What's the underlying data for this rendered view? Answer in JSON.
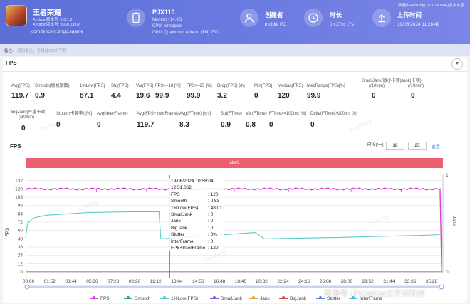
{
  "app": {
    "name": "王者荣耀",
    "android_version": "Android版本号: 9.3.1.6",
    "android_code": "Android版本号: 903010602",
    "package": "com.tencent.tmgp.sgame"
  },
  "device": {
    "name": "PJX110",
    "memory": "Memory: 14.9G",
    "cpu": "CPU: pineapple",
    "gpu": "GPU: Qualcomm Adreno (TM) 750"
  },
  "creator": {
    "label": "创建者",
    "value": "mobile PC"
  },
  "duration": {
    "label": "时长",
    "value": "0h 37m 17s"
  },
  "upload": {
    "label": "上传时间",
    "value": "19/06/2024 11:28:49"
  },
  "perfdog_version": "数据由PerfDog(10.3.240546)版本本版",
  "note": {
    "label": "备注:",
    "placeholder": "添加备注，不超过200个字符"
  },
  "section_title": "FPS",
  "stats_row1": [
    {
      "label": "Avg(FPS)",
      "value": "119.7"
    },
    {
      "label": "Smooth(稳帧指数)",
      "value": "0.9"
    },
    {
      "label": "1%Low(FPS)",
      "value": "87.1"
    },
    {
      "label": "Std(FPS)",
      "value": "4.4"
    },
    {
      "label": "Var(FPS)",
      "value": "19.6"
    },
    {
      "label": "FPS>=18 [%]",
      "value": "99.9"
    },
    {
      "label": "FPS>=25 [%]",
      "value": "99.9"
    },
    {
      "label": "Drop(FPS) [/h]",
      "value": "3.2"
    },
    {
      "label": "Min(FPS)",
      "value": "0"
    },
    {
      "label": "Median(FPS)",
      "value": "120"
    },
    {
      "label": "MedRange(FPS)[%]",
      "value": "99.9"
    },
    {
      "label": "SmallJank(微小卡顿)",
      "label2": "(/10min)",
      "value": "0"
    },
    {
      "label": "Jank(卡顿)",
      "label2": "(/10min)",
      "value": "0"
    }
  ],
  "stats_row2": [
    {
      "label": "BigJank(严重卡顿)",
      "label2": "(/10min)",
      "value": "0"
    },
    {
      "label": "Stutter(卡顿率) [%]",
      "value": "0"
    },
    {
      "label": "Avg(InterFrame)",
      "value": "0"
    },
    {
      "label": "Avg(FPS+InterFrame)",
      "value": "119.7"
    },
    {
      "label": "Avg(FTime) [ms]",
      "value": "8.3"
    },
    {
      "label": "Std(FTime)",
      "value": "0.9"
    },
    {
      "label": "Var(FTime)",
      "value": "0.8"
    },
    {
      "label": "FTime>=100ms [%]",
      "value": "0"
    },
    {
      "label": "Delta(FTime)>100ms [/h]",
      "value": "0"
    }
  ],
  "chart_header": {
    "title": "FPS",
    "range_label": "FPS(>=)",
    "range_min": "18",
    "range_max": "25",
    "reset": "重置",
    "label_bar": "label1",
    "watermark": "PerfDog"
  },
  "tooltip": {
    "timestamp": "19/06/2024 10:58:04",
    "elapsed": "12:51.062",
    "rows": [
      {
        "k": "FPS",
        "v": ": 120"
      },
      {
        "k": "Smooth",
        "v": ": 0.83"
      },
      {
        "k": "1%Low(FPS)",
        "v": ": 48.01"
      },
      {
        "k": "SmallJank",
        "v": ": 0"
      },
      {
        "k": "Jank",
        "v": ": 0"
      },
      {
        "k": "BigJank",
        "v": ": 0"
      },
      {
        "k": "Stutter",
        "v": ": 0%"
      },
      {
        "k": "InterFrame",
        "v": ": 0"
      },
      {
        "k": "FPS+InterFrame",
        "v": ": 120"
      }
    ]
  },
  "legend": [
    {
      "name": "FPS",
      "color": "#d43fd8"
    },
    {
      "name": "Smooth",
      "color": "#3aa66a"
    },
    {
      "name": "1%Low(FPS)",
      "color": "#5ac8c8"
    },
    {
      "name": "SmallJank",
      "color": "#8a5ad8"
    },
    {
      "name": "Jank",
      "color": "#e8a040"
    },
    {
      "name": "BigJank",
      "color": "#d44a4a"
    },
    {
      "name": "Stutter",
      "color": "#5a8ad8"
    },
    {
      "name": "InterFrame",
      "color": "#3ac8d8"
    }
  ],
  "site_watermark": "风景号 | PConline太平洋科技",
  "chart_data": {
    "type": "line",
    "ylabel": "FPS",
    "y2label": "Jank",
    "ylim": [
      0,
      140
    ],
    "y2lim": [
      0,
      1
    ],
    "yticks": [
      0,
      12,
      24,
      36,
      48,
      60,
      72,
      84,
      96,
      108,
      120,
      132
    ],
    "y2ticks": [
      0,
      1
    ],
    "x_ticks": [
      "00:00",
      "01:52",
      "03:44",
      "05:36",
      "07:28",
      "09:20",
      "11:12",
      "13:04",
      "14:56",
      "16:48",
      "18:40",
      "20:32",
      "22:24",
      "24:16",
      "26:08",
      "28:00",
      "29:52",
      "31:44",
      "33:36",
      "35:28"
    ],
    "series": [
      {
        "name": "FPS",
        "x": [
          "00:00",
          "00:10",
          "13:04",
          "20:32",
          "28:00",
          "35:28",
          "37:00",
          "37:10"
        ],
        "values": [
          118,
          120,
          120,
          120,
          120,
          120,
          120,
          2
        ]
      },
      {
        "name": "1%Low(FPS)",
        "x": [
          "00:00",
          "00:10",
          "00:40",
          "01:52",
          "03:44",
          "05:36",
          "09:20",
          "11:55",
          "12:05",
          "13:04",
          "20:32",
          "21:20",
          "28:00",
          "35:28",
          "37:00"
        ],
        "values": [
          50,
          70,
          78,
          82,
          84,
          86,
          87,
          87,
          48,
          49,
          57,
          48,
          50,
          53,
          54
        ]
      }
    ],
    "cursor_at": "12:51.062"
  }
}
